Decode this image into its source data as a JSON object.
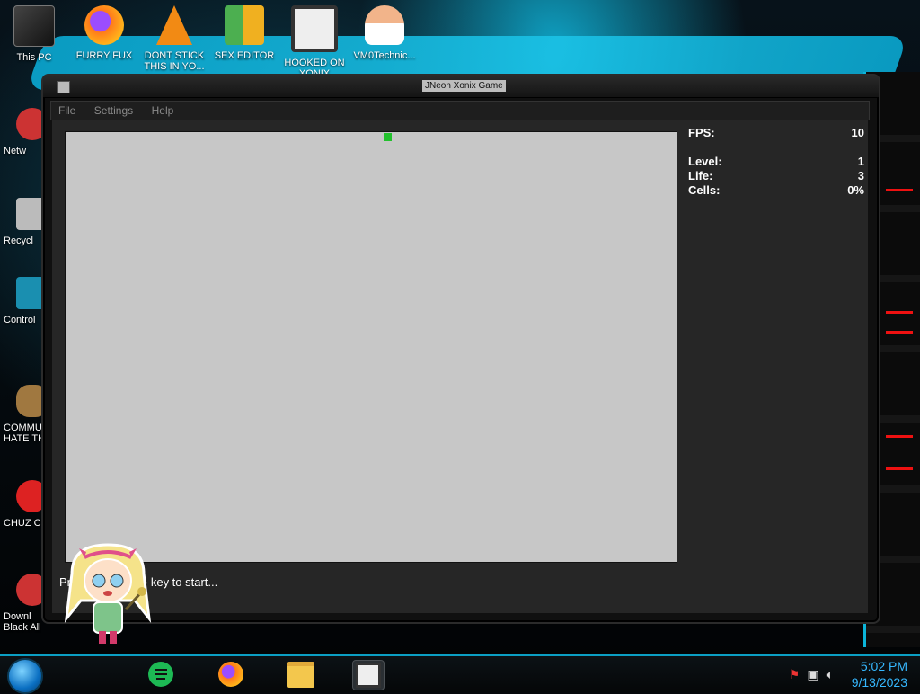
{
  "desktop": {
    "top_icons": [
      {
        "label": "This PC"
      },
      {
        "label": "FURRY FUX"
      },
      {
        "label": "DONT STICK THIS IN YO..."
      },
      {
        "label": "SEX EDITOR"
      },
      {
        "label": "HOOKED ON XONIX"
      },
      {
        "label": "VM0Technic..."
      }
    ],
    "left_icons": [
      {
        "label": "Netw"
      },
      {
        "label": "Recycl"
      },
      {
        "label": "Control"
      },
      {
        "label": "COMMU HATE TH"
      },
      {
        "label": "CHUZ CUI"
      },
      {
        "label": "Downl Black All..."
      }
    ]
  },
  "window": {
    "title": "JNeon Xonix Game",
    "menu": [
      {
        "label": "File"
      },
      {
        "label": "Settings"
      },
      {
        "label": "Help"
      }
    ],
    "stats": {
      "fps_label": "FPS:",
      "fps_value": "10",
      "level_label": "Level:",
      "level_value": "1",
      "life_label": "Life:",
      "life_value": "3",
      "cells_label": "Cells:",
      "cells_value": "0%"
    },
    "prompt_left": "Pr",
    "prompt_right": "» key to start..."
  },
  "taskbar": {
    "time": "5:02 PM",
    "date": "9/13/2023"
  },
  "colors": {
    "accent": "#0bb4d9",
    "player": "#22c12d",
    "game_bg": "#c7c7c7"
  }
}
